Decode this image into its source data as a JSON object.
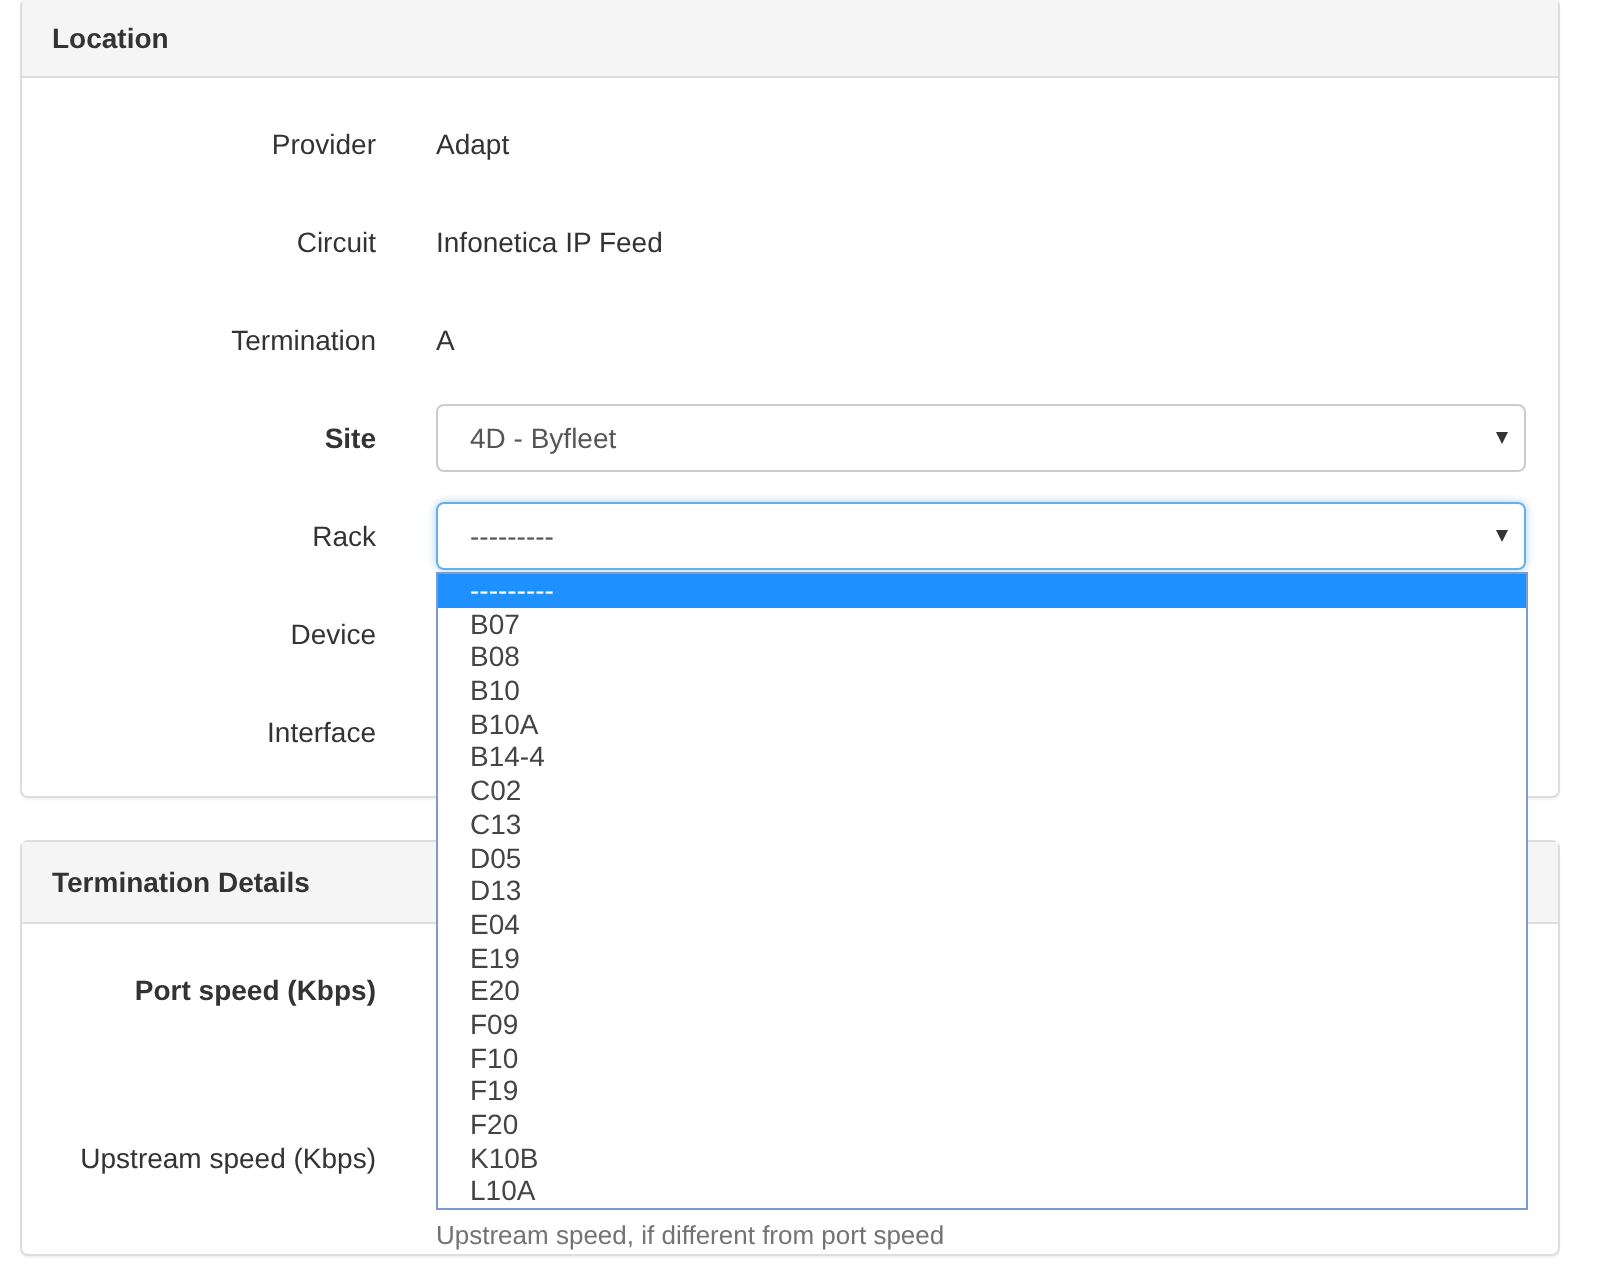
{
  "panels": [
    {
      "title": "Location",
      "rows": [
        {
          "label": "Provider",
          "bold": false,
          "kind": "text",
          "value": "Adapt"
        },
        {
          "label": "Circuit",
          "bold": false,
          "kind": "text",
          "value": "Infonetica IP Feed"
        },
        {
          "label": "Termination",
          "bold": false,
          "kind": "text",
          "value": "A"
        },
        {
          "label": "Site",
          "bold": true,
          "kind": "select",
          "value": "4D - Byfleet",
          "focused": false
        },
        {
          "label": "Rack",
          "bold": false,
          "kind": "select",
          "value": "---------",
          "focused": true,
          "options": [
            {
              "label": "---------",
              "selected": true
            },
            {
              "label": "B07",
              "selected": false
            },
            {
              "label": "B08",
              "selected": false
            },
            {
              "label": "B10",
              "selected": false
            },
            {
              "label": "B10A",
              "selected": false
            },
            {
              "label": "B14-4",
              "selected": false
            },
            {
              "label": "C02",
              "selected": false
            },
            {
              "label": "C13",
              "selected": false
            },
            {
              "label": "D05",
              "selected": false
            },
            {
              "label": "D13",
              "selected": false
            },
            {
              "label": "E04",
              "selected": false
            },
            {
              "label": "E19",
              "selected": false
            },
            {
              "label": "E20",
              "selected": false
            },
            {
              "label": "F09",
              "selected": false
            },
            {
              "label": "F10",
              "selected": false
            },
            {
              "label": "F19",
              "selected": false
            },
            {
              "label": "F20",
              "selected": false
            },
            {
              "label": "K10B",
              "selected": false
            },
            {
              "label": "L10A",
              "selected": false
            }
          ]
        },
        {
          "label": "Device",
          "bold": false,
          "kind": "covered"
        },
        {
          "label": "Interface",
          "bold": false,
          "kind": "covered"
        }
      ]
    },
    {
      "title": "Termination Details",
      "rows": [
        {
          "label": "Port speed (Kbps)",
          "bold": true,
          "kind": "covered"
        },
        {
          "label": "Upstream speed (Kbps)",
          "bold": false,
          "kind": "covered",
          "help": "Upstream speed, if different from port speed"
        }
      ]
    }
  ]
}
